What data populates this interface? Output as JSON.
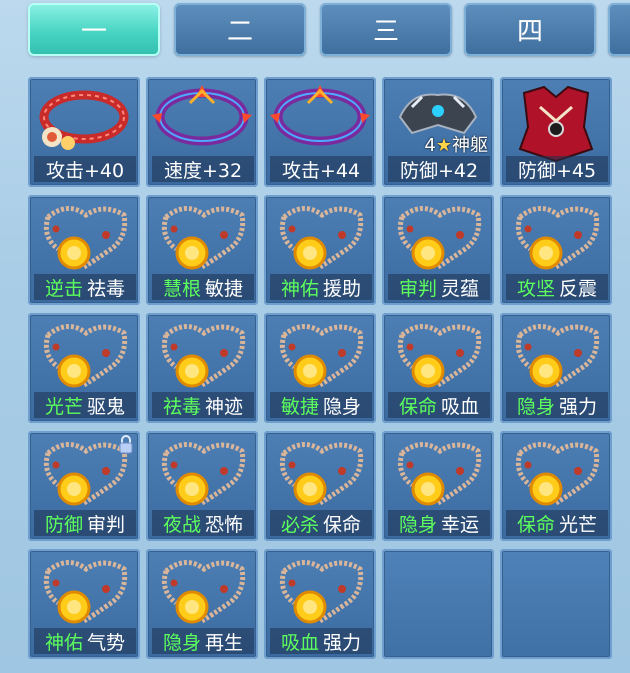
{
  "tabs": [
    {
      "label": "一",
      "active": true
    },
    {
      "label": "二",
      "active": false
    },
    {
      "label": "三",
      "active": false
    },
    {
      "label": "四",
      "active": false
    }
  ],
  "equipment": [
    {
      "kind": "bracelet",
      "label": "攻击+40"
    },
    {
      "kind": "headband",
      "label": "速度+32"
    },
    {
      "kind": "headband",
      "label": "攻击+44"
    },
    {
      "kind": "shoulder",
      "label": "防御+42",
      "badge": {
        "level": "4",
        "star": "★",
        "text": "神躯"
      }
    },
    {
      "kind": "armor",
      "label": "防御+45"
    }
  ],
  "necklaces": [
    {
      "green": "逆击",
      "white": "祛毒"
    },
    {
      "green": "慧根",
      "white": "敏捷"
    },
    {
      "green": "神佑",
      "white": "援助"
    },
    {
      "green": "审判",
      "white": "灵蕴"
    },
    {
      "green": "攻坚",
      "white": "反震"
    },
    {
      "green": "光芒",
      "white": "驱鬼"
    },
    {
      "green": "祛毒",
      "white": "神迹"
    },
    {
      "green": "敏捷",
      "white": "隐身"
    },
    {
      "green": "保命",
      "white": "吸血"
    },
    {
      "green": "隐身",
      "white": "强力"
    },
    {
      "green": "防御",
      "white": "审判",
      "locked": true
    },
    {
      "green": "夜战",
      "white": "恐怖"
    },
    {
      "green": "必杀",
      "white": "保命"
    },
    {
      "green": "隐身",
      "white": "幸运"
    },
    {
      "green": "保命",
      "white": "光芒"
    },
    {
      "green": "神佑",
      "white": "气势"
    },
    {
      "green": "隐身",
      "white": "再生"
    },
    {
      "green": "吸血",
      "white": "强力"
    }
  ],
  "empty_slots": 2,
  "colors": {
    "green_text": "#5cff5c",
    "active_tab": "#48d4c3",
    "slot": "#3f70a6"
  }
}
